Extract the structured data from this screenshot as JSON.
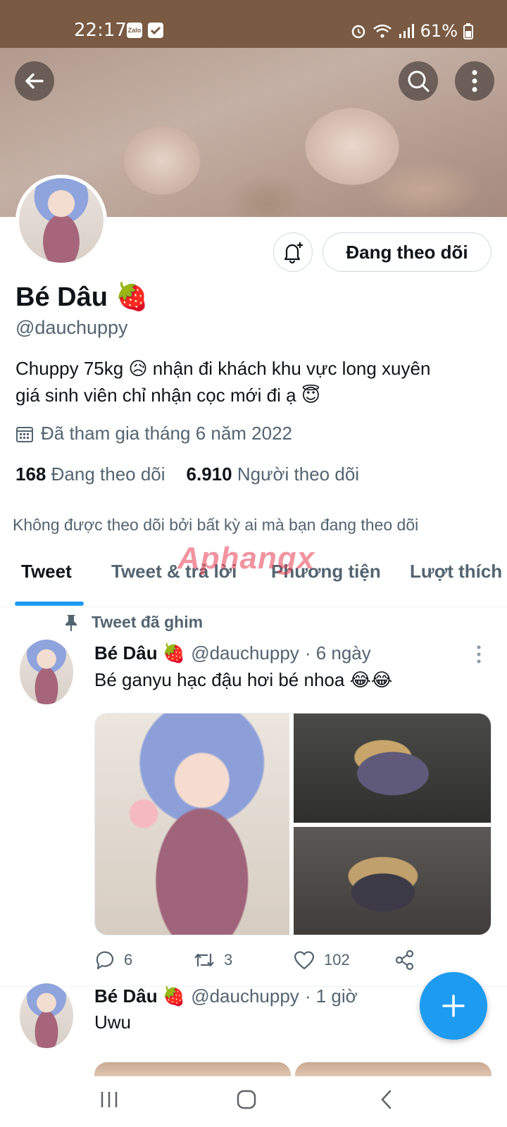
{
  "status_bar": {
    "time": "22:17",
    "app_icon_1": "Zalo",
    "battery": "61%"
  },
  "header": {
    "back_icon": "arrow-left-icon",
    "search_icon": "search-icon",
    "more_icon": "more-vertical-icon"
  },
  "profile": {
    "follow_button": "Đang theo dõi",
    "name": "Bé Dâu 🍓",
    "handle": "@dauchuppy",
    "bio_line_1": "Chuppy 75kg 😥 nhận đi khách khu vực long xuyên",
    "bio_line_2": "giá sinh viên chỉ nhận cọc mới đi ạ 😇",
    "joined": "Đã tham gia tháng 6 năm 2022",
    "following_count": "168",
    "following_label": "Đang theo dõi",
    "followers_count": "6.910",
    "followers_label": "Người theo dõi",
    "followed_by": "Không được theo dõi bởi bất kỳ ai mà bạn đang theo dõi"
  },
  "watermark": "Aphangx",
  "tabs": [
    {
      "label": "Tweet"
    },
    {
      "label": "Tweet & trả lời"
    },
    {
      "label": "Phương tiện"
    },
    {
      "label": "Lượt thích"
    }
  ],
  "tweets": [
    {
      "pinned_label": "Tweet đã ghim",
      "name": "Bé Dâu 🍓",
      "handle": "@dauchuppy",
      "time": "· 6 ngày",
      "text": "Bé ganyu hạc đậu hơi bé nhoa 😂😂",
      "replies": "6",
      "retweets": "3",
      "likes": "102"
    },
    {
      "name": "Bé Dâu 🍓",
      "handle": "@dauchuppy",
      "time": "· 1 giờ",
      "text": "Uwu"
    }
  ],
  "colors": {
    "accent": "#1d9bf0",
    "status_bar": "#7a5a43",
    "text_secondary": "#536471"
  }
}
